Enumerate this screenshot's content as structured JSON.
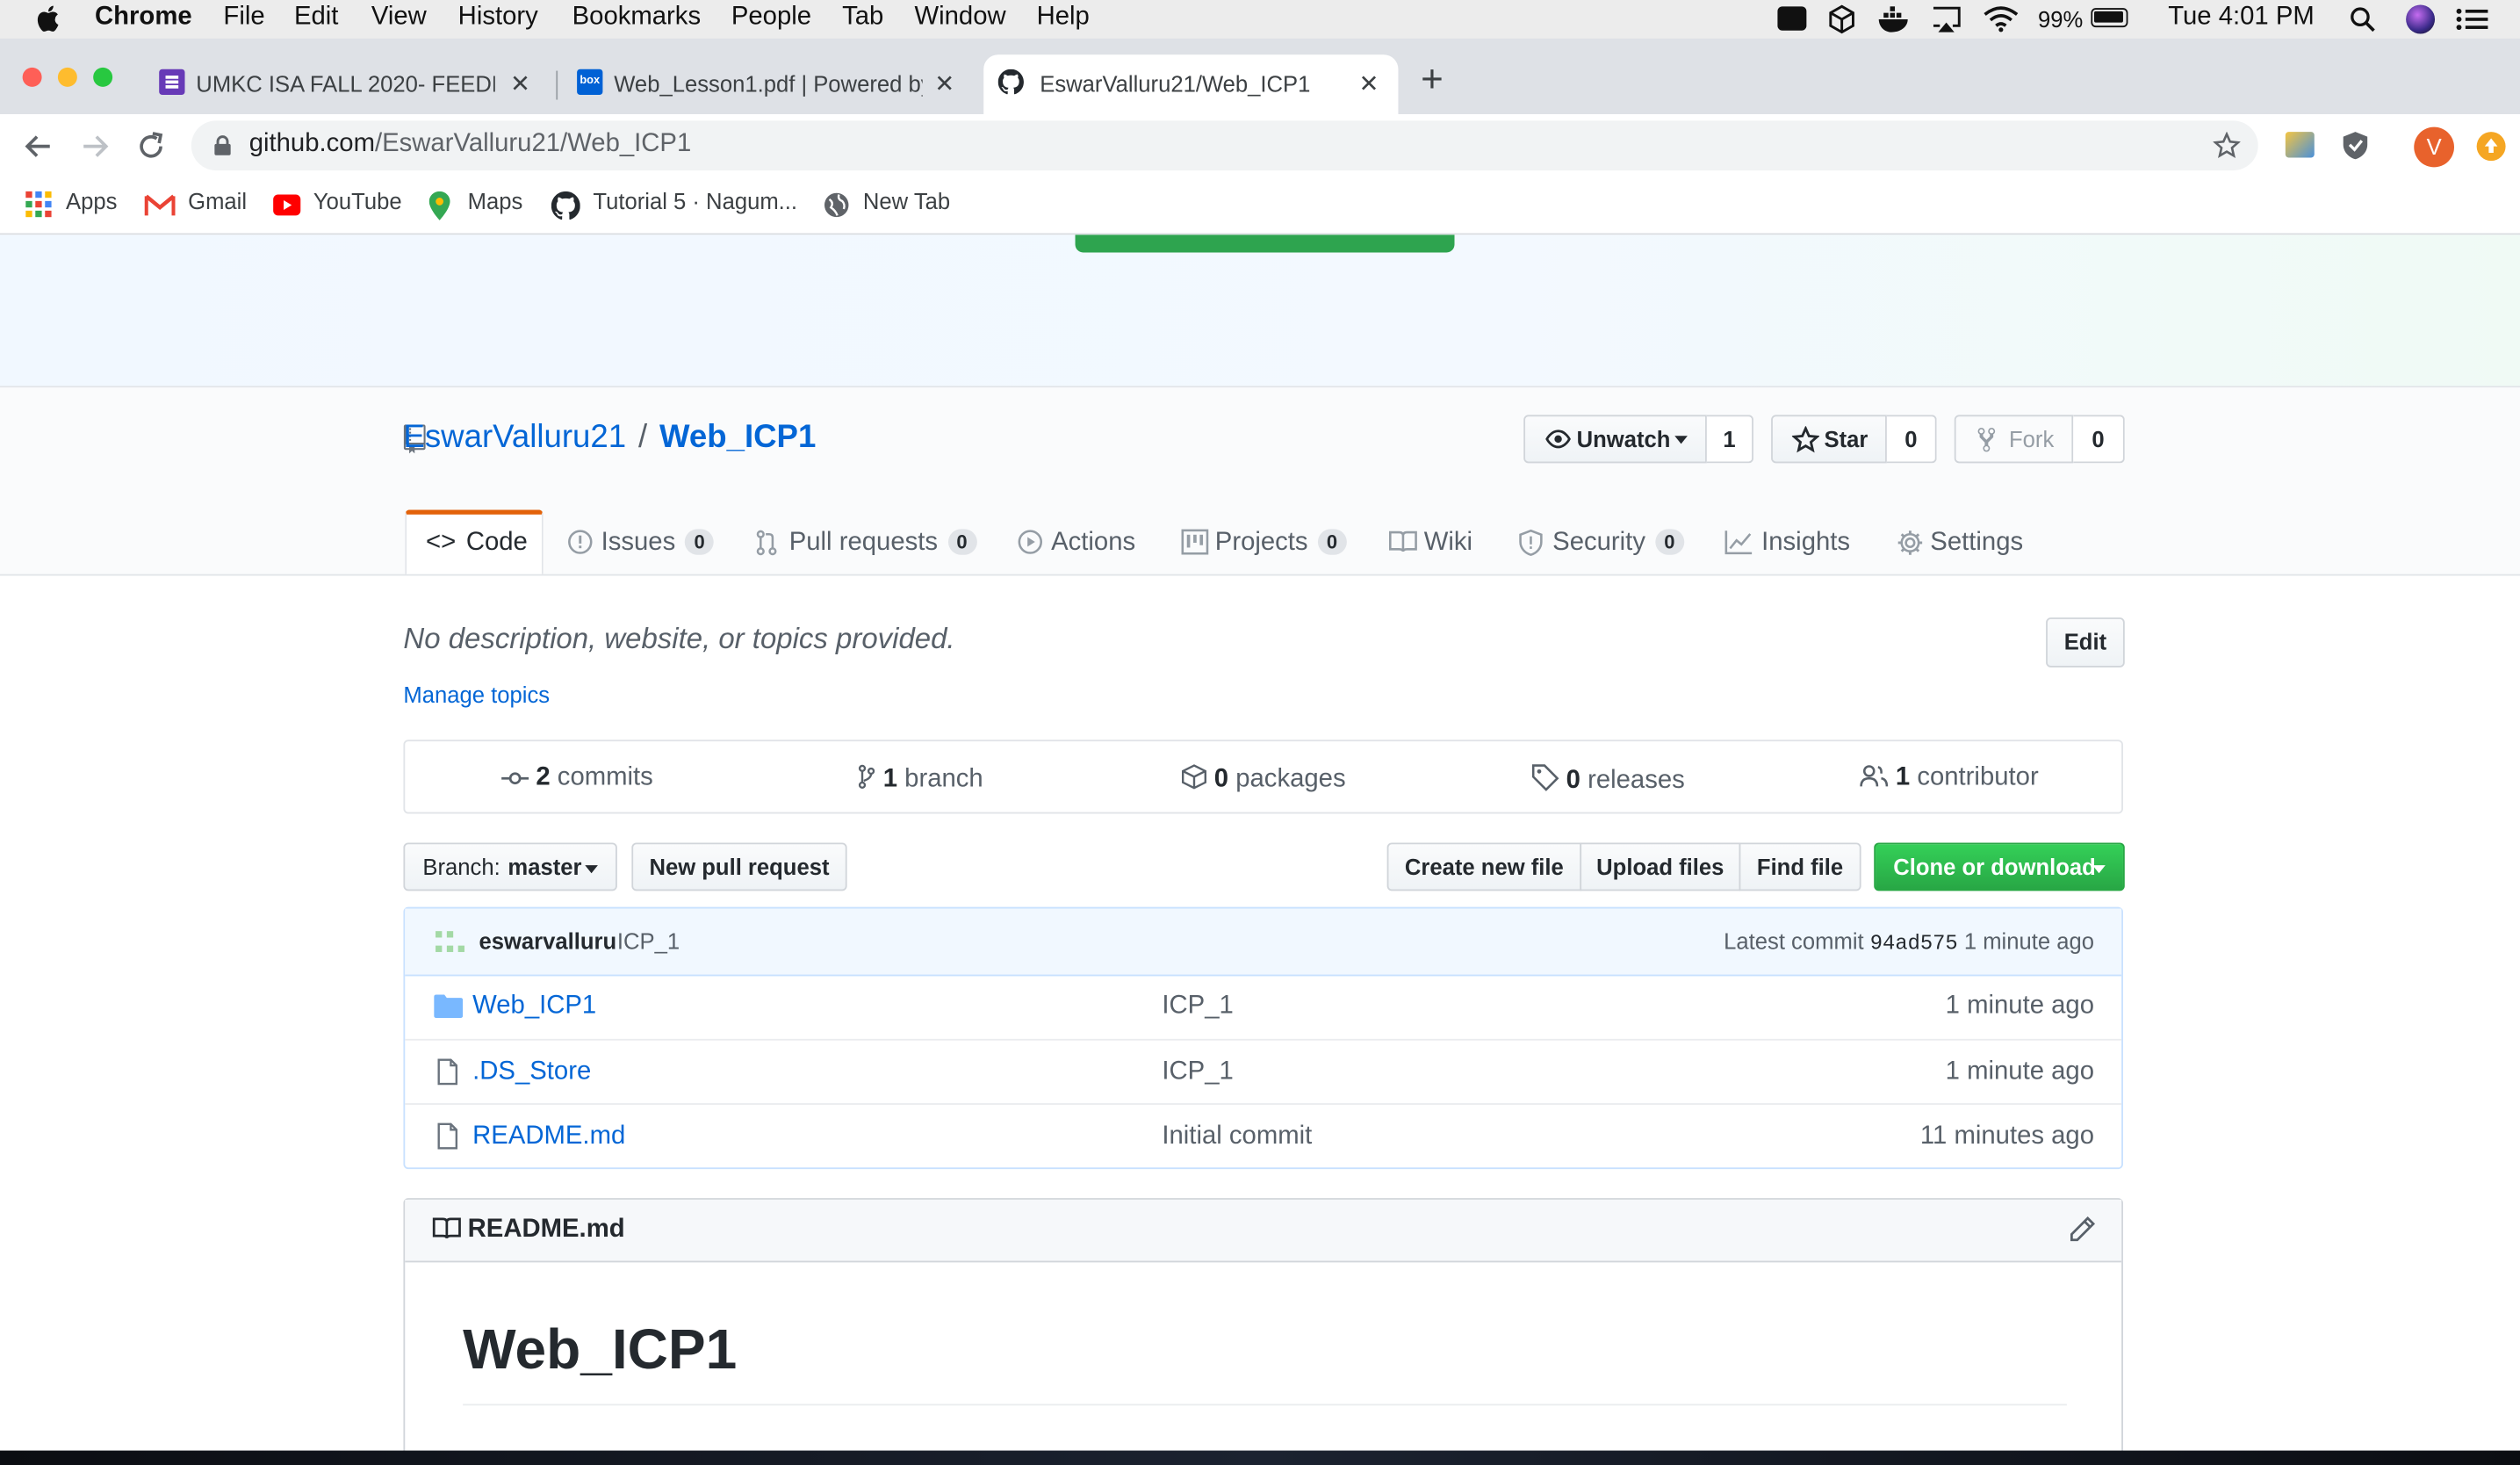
{
  "menubar": {
    "app": "Chrome",
    "menus": [
      "File",
      "Edit",
      "View",
      "History",
      "Bookmarks",
      "People",
      "Tab",
      "Window",
      "Help"
    ],
    "battery": "99%",
    "clock": "Tue 4:01 PM"
  },
  "tabs": [
    {
      "title": "UMKC ISA FALL 2020- FEEDBA",
      "icon": "forms-icon",
      "active": false
    },
    {
      "title": "Web_Lesson1.pdf | Powered by",
      "icon": "box-icon",
      "active": false
    },
    {
      "title": "EswarValluru21/Web_ICP1",
      "icon": "github-icon",
      "active": true
    }
  ],
  "address": {
    "host": "github.com",
    "path": "/EswarValluru21/Web_ICP1"
  },
  "profile_initial": "V",
  "bookmarks": [
    "Apps",
    "Gmail",
    "YouTube",
    "Maps",
    "Tutorial 5 · Nagum...",
    "New Tab"
  ],
  "repo": {
    "owner": "EswarValluru21",
    "separator": "/",
    "name": "Web_ICP1",
    "watch_label": "Unwatch",
    "watch_count": "1",
    "star_label": "Star",
    "star_count": "0",
    "fork_label": "Fork",
    "fork_count": "0"
  },
  "nav": [
    {
      "label": "Code"
    },
    {
      "label": "Issues",
      "count": "0"
    },
    {
      "label": "Pull requests",
      "count": "0"
    },
    {
      "label": "Actions"
    },
    {
      "label": "Projects",
      "count": "0"
    },
    {
      "label": "Wiki"
    },
    {
      "label": "Security",
      "count": "0"
    },
    {
      "label": "Insights"
    },
    {
      "label": "Settings"
    }
  ],
  "description": "No description, website, or topics provided.",
  "edit_label": "Edit",
  "manage_topics": "Manage topics",
  "numbers": {
    "commits_n": "2",
    "commits_label": "commits",
    "branch_n": "1",
    "branch_label": "branch",
    "packages_n": "0",
    "packages_label": "packages",
    "releases_n": "0",
    "releases_label": "releases",
    "contributors_n": "1",
    "contributors_label": "contributor"
  },
  "actions": {
    "branch_prefix": "Branch:",
    "branch_name": "master",
    "new_pr": "New pull request",
    "create_file": "Create new file",
    "upload": "Upload files",
    "find": "Find file",
    "clone": "Clone or download"
  },
  "latest_commit": {
    "author": "eswarvalluru",
    "message": "ICP_1",
    "prefix": "Latest commit",
    "sha": "94ad575",
    "age": "1 minute ago"
  },
  "files": [
    {
      "name": "Web_ICP1",
      "type": "folder",
      "message": "ICP_1",
      "age": "1 minute ago"
    },
    {
      "name": ".DS_Store",
      "type": "file",
      "message": "ICP_1",
      "age": "1 minute ago"
    },
    {
      "name": "README.md",
      "type": "file",
      "message": "Initial commit",
      "age": "11 minutes ago"
    }
  ],
  "readme": {
    "filename": "README.md",
    "heading": "Web_ICP1"
  },
  "colors": {
    "link": "#0366d6",
    "clone_green": "#28a745",
    "active_tab_orange": "#e36209"
  }
}
